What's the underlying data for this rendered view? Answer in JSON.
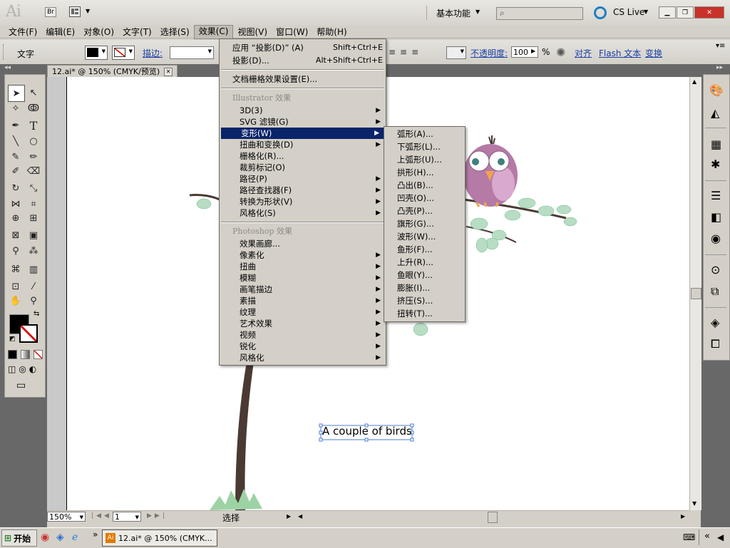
{
  "app": {
    "logo": "Ai",
    "bridge_label": "Br",
    "workspace": "基本功能",
    "cslive": "CS Live"
  },
  "menubar": [
    "文件(F)",
    "编辑(E)",
    "对象(O)",
    "文字(T)",
    "选择(S)",
    "效果(C)",
    "视图(V)",
    "窗口(W)",
    "帮助(H)"
  ],
  "control": {
    "tool_label": "文字",
    "stroke_label": "描边:",
    "opacity_label": "不透明度:",
    "opacity_value": "100",
    "percent": "%",
    "align_label": "对齐",
    "flash_label": "Flash 文本",
    "transform_label": "变换"
  },
  "document": {
    "tab_title": "12.ai* @ 150% (CMYK/预览)",
    "text_object": "A couple of birds"
  },
  "effect_menu": {
    "apply_item": "应用 “投影(D)” (A)",
    "apply_shortcut": "Shift+Ctrl+E",
    "shadow_item": "投影(D)...",
    "shadow_shortcut": "Alt+Shift+Ctrl+E",
    "raster_settings": "文档栅格效果设置(E)...",
    "illustrator_header": "Illustrator 效果",
    "illustrator_items": [
      "3D(3)",
      "SVG 滤镜(G)",
      "变形(W)",
      "扭曲和变换(D)",
      "栅格化(R)...",
      "裁剪标记(O)",
      "路径(P)",
      "路径查找器(F)",
      "转换为形状(V)",
      "风格化(S)"
    ],
    "photoshop_header": "Photoshop 效果",
    "photoshop_items": [
      "效果画廊...",
      "像素化",
      "扭曲",
      "模糊",
      "画笔描边",
      "素描",
      "纹理",
      "艺术效果",
      "视频",
      "锐化",
      "风格化"
    ]
  },
  "warp_submenu": [
    "弧形(A)...",
    "下弧形(L)...",
    "上弧形(U)...",
    "拱形(H)...",
    "凸出(B)...",
    "凹壳(O)...",
    "凸壳(P)...",
    "旗形(G)...",
    "波形(W)...",
    "鱼形(F)...",
    "上升(R)...",
    "鱼眼(Y)...",
    "膨胀(I)...",
    "挤压(S)...",
    "扭转(T)..."
  ],
  "statusbar": {
    "zoom": "150%",
    "page": "1",
    "mode": "选择"
  },
  "taskbar": {
    "start": "开始",
    "task": "12.ai* @ 150% (CMYK..."
  },
  "colors": {
    "selection_blue": "#0a246a",
    "owl_body": "#b57aa6",
    "branch": "#4a3a33",
    "leaf": "#b8dcc4"
  }
}
